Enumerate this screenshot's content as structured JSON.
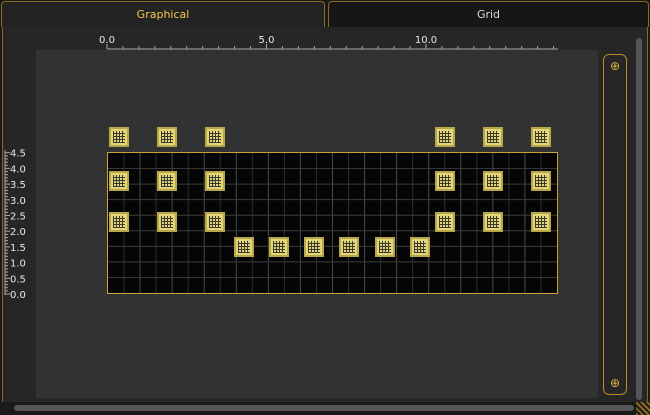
{
  "tabs": [
    {
      "label": "Graphical",
      "active": true
    },
    {
      "label": "Grid",
      "active": false
    }
  ],
  "x_ruler": {
    "labels": [
      "0.0",
      "5.0",
      "10.0"
    ],
    "values": [
      0,
      5,
      10
    ],
    "range": [
      0,
      14
    ]
  },
  "y_ruler": {
    "labels": [
      "4.5",
      "4.0",
      "3.5",
      "3.0",
      "2.5",
      "2.0",
      "1.5",
      "1.0",
      "0.5",
      "0.0"
    ],
    "values": [
      4.5,
      4.0,
      3.5,
      3.0,
      2.5,
      2.0,
      1.5,
      1.0,
      0.5,
      0.0
    ]
  },
  "fixtures": [
    {
      "x": 0.38,
      "y": 5.0
    },
    {
      "x": 1.88,
      "y": 5.0
    },
    {
      "x": 3.38,
      "y": 5.0
    },
    {
      "x": 10.6,
      "y": 5.0
    },
    {
      "x": 12.1,
      "y": 5.0
    },
    {
      "x": 13.6,
      "y": 5.0
    },
    {
      "x": 0.38,
      "y": 3.6
    },
    {
      "x": 1.88,
      "y": 3.6
    },
    {
      "x": 3.38,
      "y": 3.6
    },
    {
      "x": 10.6,
      "y": 3.6
    },
    {
      "x": 12.1,
      "y": 3.6
    },
    {
      "x": 13.6,
      "y": 3.6
    },
    {
      "x": 0.38,
      "y": 2.3
    },
    {
      "x": 1.88,
      "y": 2.3
    },
    {
      "x": 3.38,
      "y": 2.3
    },
    {
      "x": 10.6,
      "y": 2.3
    },
    {
      "x": 12.1,
      "y": 2.3
    },
    {
      "x": 13.6,
      "y": 2.3
    },
    {
      "x": 4.3,
      "y": 1.5
    },
    {
      "x": 5.4,
      "y": 1.5
    },
    {
      "x": 6.5,
      "y": 1.5
    },
    {
      "x": 7.6,
      "y": 1.5
    },
    {
      "x": 8.7,
      "y": 1.5
    },
    {
      "x": 9.8,
      "y": 1.5
    }
  ],
  "icons": {
    "zoom_in": "zoom-in-icon",
    "zoom_out": "zoom-out-icon"
  },
  "colors": {
    "accent": "#e0b545",
    "stage_border": "#c9a43a",
    "fixture": "#e3d57a"
  }
}
